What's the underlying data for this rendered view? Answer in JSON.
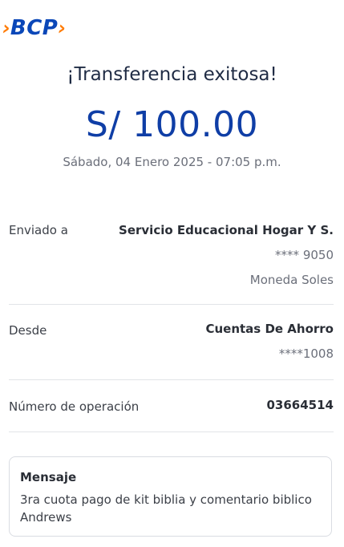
{
  "brand": {
    "name": "BCP",
    "chevron_left": "›",
    "chevron_right": "›",
    "colors": {
      "blue": "#0a47b8",
      "orange": "#ff7a00"
    }
  },
  "header": {
    "title": "¡Transferencia exitosa!",
    "amount": "S/ 100.00",
    "date": "Sábado, 04 Enero 2025 - 07:05 p.m."
  },
  "details": {
    "sent_to": {
      "label": "Enviado a",
      "name": "Servicio Educacional Hogar Y S.",
      "account": "**** 9050",
      "currency": "Moneda Soles"
    },
    "from": {
      "label": "Desde",
      "name": "Cuentas De Ahorro",
      "account": "****1008"
    },
    "operation": {
      "label": "Número de operación",
      "number": "03664514"
    }
  },
  "message": {
    "title": "Mensaje",
    "body": "3ra cuota pago de kit biblia y comentario biblico Andrews"
  }
}
